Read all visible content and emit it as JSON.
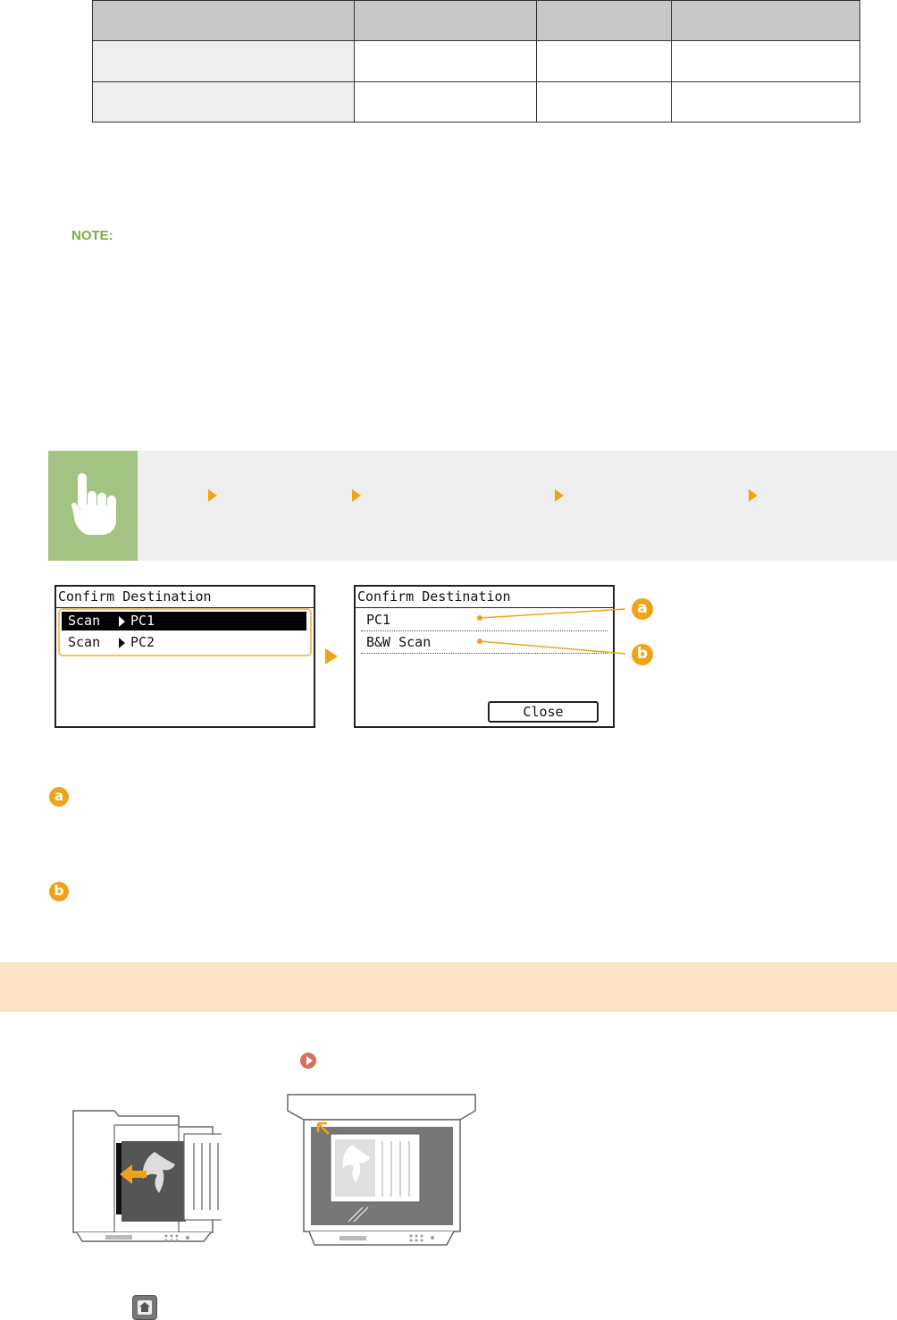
{
  "screen_left": {
    "title": "Confirm Destination",
    "items": [
      {
        "label": "Scan",
        "target": "PC1"
      },
      {
        "label": "Scan",
        "target": "PC2"
      }
    ]
  },
  "screen_right": {
    "title": "Confirm Destination",
    "items": [
      "PC1",
      "B&W Scan"
    ],
    "close_button": "Close"
  },
  "callouts": {
    "a": "a",
    "b": "b"
  },
  "note_label": "NOTE:",
  "icons": {
    "hand": "hand-pointer-icon",
    "arrow": "right-triangle-arrow-icon",
    "link": "play-circle-icon",
    "home": "home-icon",
    "adf": "adf-feeder-illustration",
    "platen": "platen-glass-illustration"
  },
  "colors": {
    "accent": "#f0a31a",
    "note": "#7cae3a",
    "op_icon_bg": "#a3c382",
    "banner": "#fce4c4"
  }
}
